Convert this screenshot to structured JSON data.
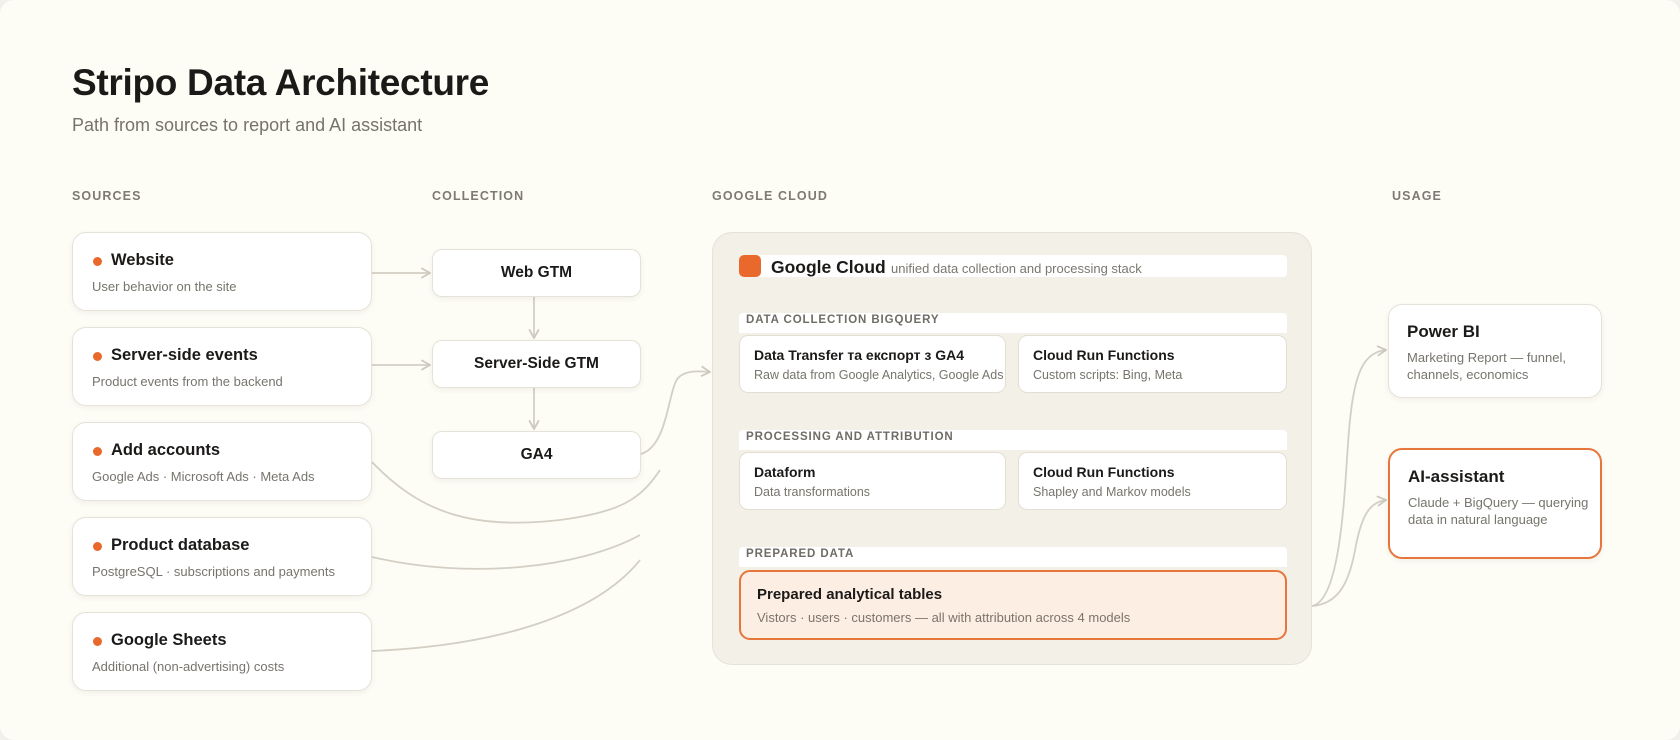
{
  "header": {
    "title": "Stripo Data Architecture",
    "subtitle": "Path from sources to report and AI assistant"
  },
  "columns": {
    "sources": "SOURCES",
    "collection": "COLLECTION",
    "google_cloud": "GOOGLE CLOUD",
    "usage": "USAGE"
  },
  "sources": [
    {
      "name": "Website",
      "desc": "User behavior on the site"
    },
    {
      "name": "Server-side events",
      "desc": "Product events from the backend"
    },
    {
      "name": "Add accounts",
      "desc": "Google Ads · Microsoft Ads · Meta Ads"
    },
    {
      "name": "Product database",
      "desc": "PostgreSQL · subscriptions and payments"
    },
    {
      "name": "Google Sheets",
      "desc": "Additional (non-advertising) costs"
    }
  ],
  "collection": [
    {
      "name": "Web GTM"
    },
    {
      "name": "Server-Side GTM"
    },
    {
      "name": "GA4"
    }
  ],
  "google_cloud": {
    "name": "Google Cloud",
    "subtitle": "unified data collection and processing stack",
    "sections": [
      {
        "label": "DATA COLLECTION BIGQUERY",
        "items": [
          {
            "name": "Data Transfer та експорт з GA4",
            "desc": "Raw data from Google Analytics, Google Ads"
          },
          {
            "name": "Cloud Run Functions",
            "desc": "Custom scripts: Bing, Meta"
          }
        ]
      },
      {
        "label": "PROCESSING AND ATTRIBUTION",
        "items": [
          {
            "name": "Dataform",
            "desc": "Data transformations"
          },
          {
            "name": "Cloud Run Functions",
            "desc": "Shapley and Markov models"
          }
        ]
      },
      {
        "label": "PREPARED DATA",
        "items": [
          {
            "name": "Prepared analytical tables",
            "desc": "Vistors · users · customers — all with attribution across 4 models"
          }
        ]
      }
    ]
  },
  "usage": [
    {
      "name": "Power BI",
      "desc": "Marketing Report — funnel, channels, economics"
    },
    {
      "name": "AI-assistant",
      "desc": "Claude + BigQuery — querying data in natural language"
    }
  ],
  "colors": {
    "accent": "#e9692c",
    "background": "#fdfcf5",
    "connector": "#d3cfc4",
    "highlight_fill": "#fdeee4"
  },
  "icons": {
    "google_cloud": "orange-square-icon",
    "source_marker": "orange-dot-icon"
  }
}
